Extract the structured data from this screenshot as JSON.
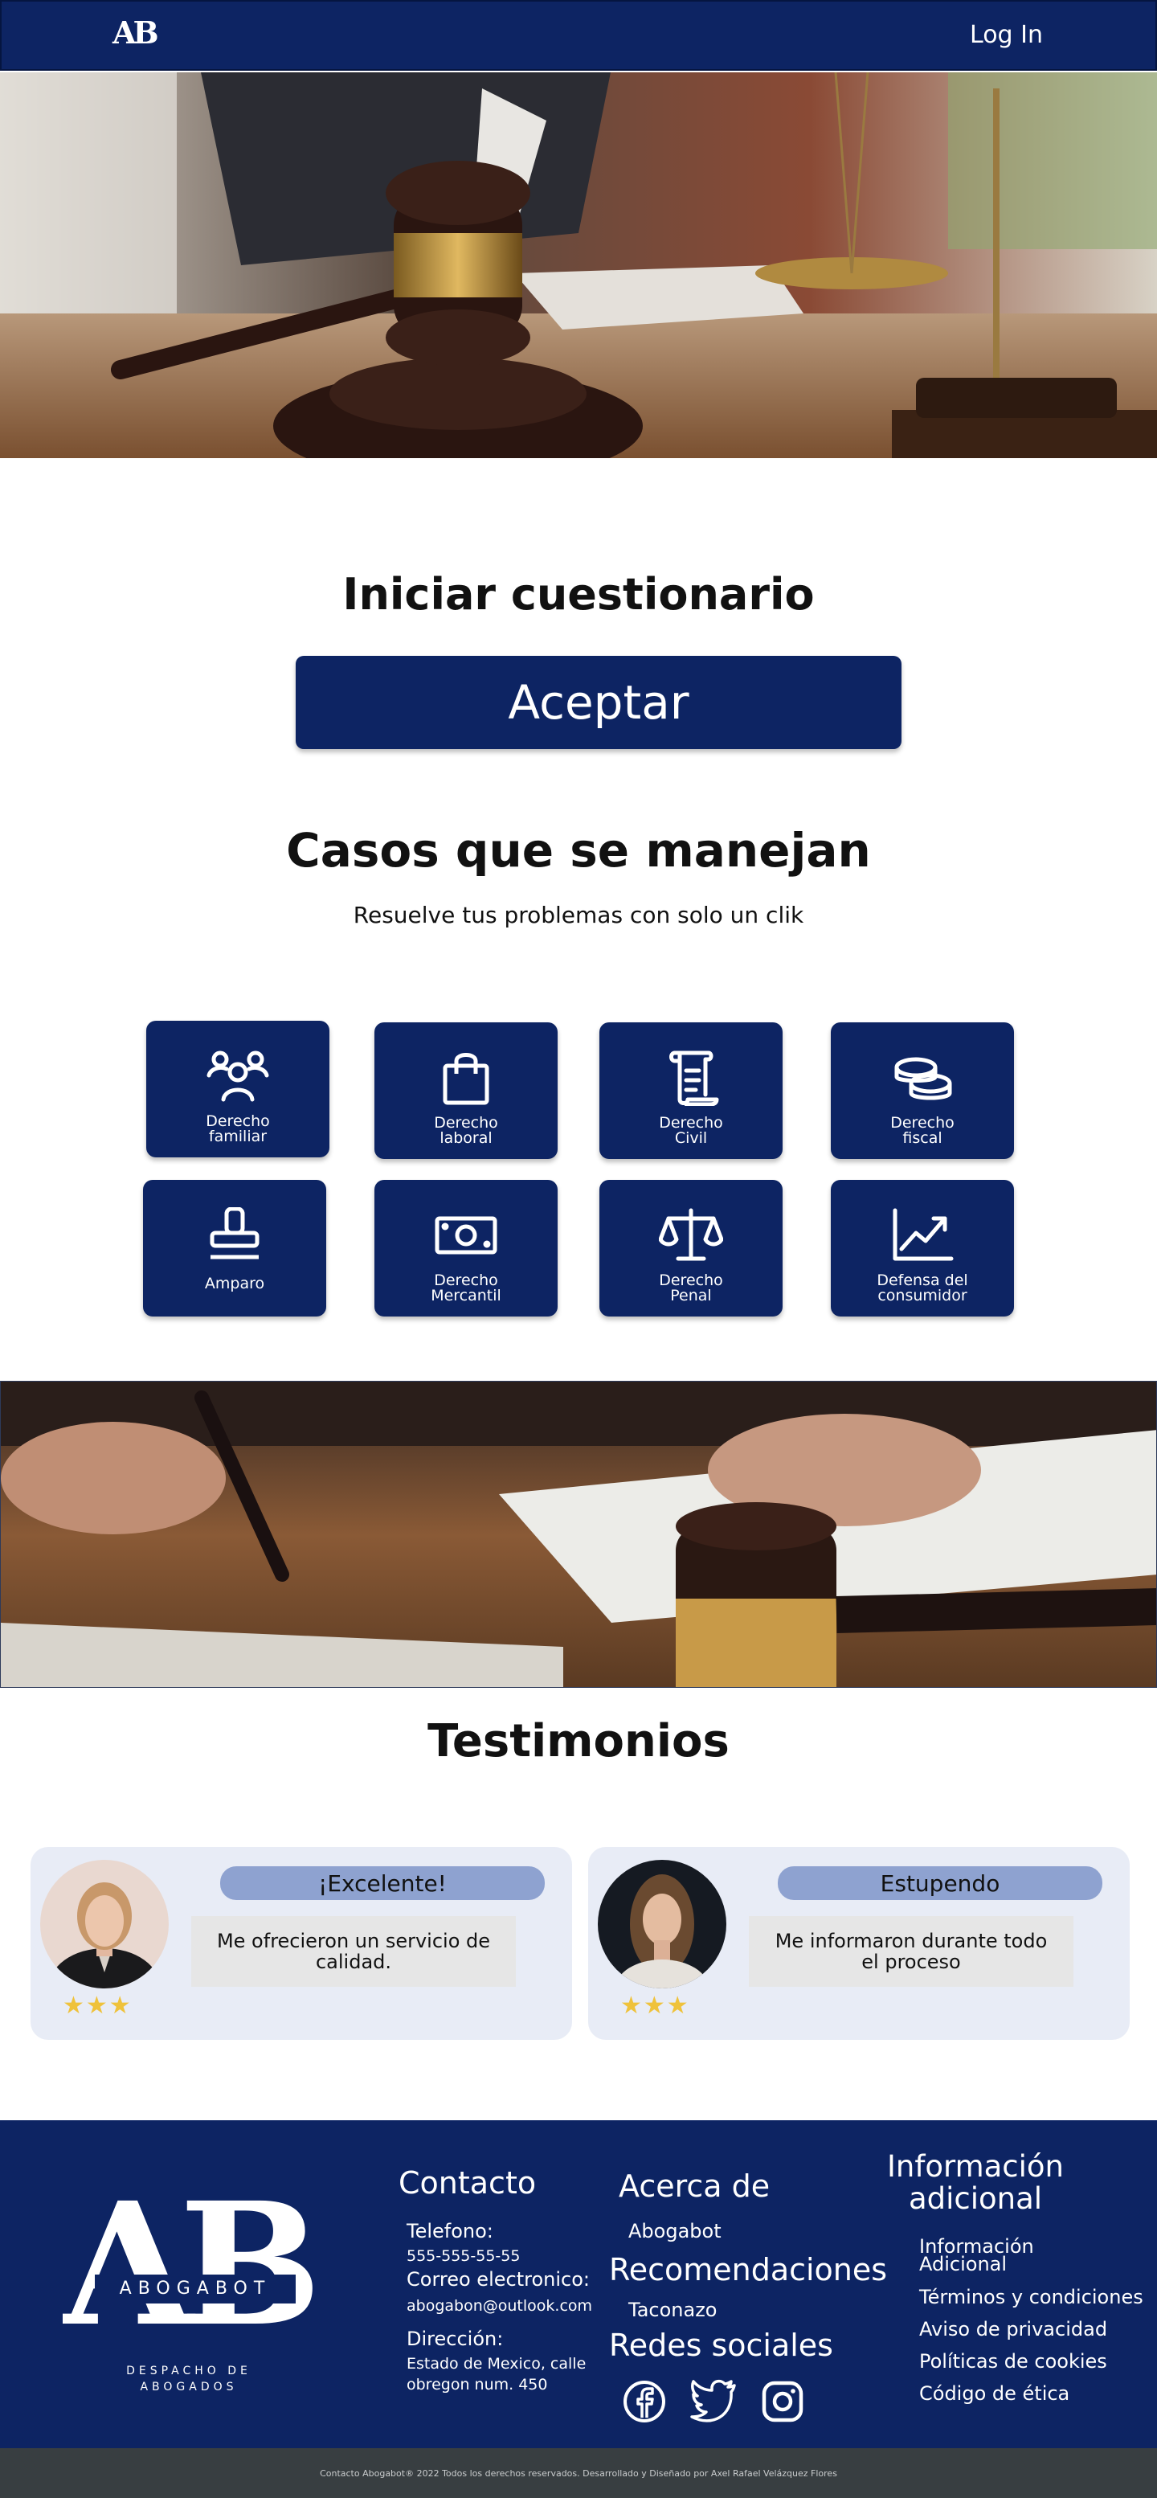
{
  "nav": {
    "logo": "AB",
    "login": "Log In"
  },
  "quiz": {
    "title": "Iniciar cuestionario",
    "button": "Aceptar"
  },
  "cases": {
    "title": "Casos que se manejan",
    "subtitle": "Resuelve tus problemas con solo un clik",
    "items": [
      {
        "line1": "Derecho",
        "line2": "familiar",
        "icon": "family-icon"
      },
      {
        "line1": "Derecho",
        "line2": "laboral",
        "icon": "shopping-bag-icon"
      },
      {
        "line1": "Derecho",
        "line2": "Civil",
        "icon": "scroll-icon"
      },
      {
        "line1": "Derecho",
        "line2": "fiscal",
        "icon": "coins-icon"
      },
      {
        "line1": "Amparo",
        "line2": "",
        "icon": "stamp-icon"
      },
      {
        "line1": "Derecho",
        "line2": "Mercantil",
        "icon": "money-bill-icon"
      },
      {
        "line1": "Derecho",
        "line2": "Penal",
        "icon": "scales-icon"
      },
      {
        "line1": "Defensa del",
        "line2": "consumidor",
        "icon": "chart-line-icon"
      }
    ]
  },
  "testimonials": {
    "title": "Testimonios",
    "items": [
      {
        "badge": "¡Excelente!",
        "quote": "Me ofrecieron un servicio de calidad.",
        "stars": "★★★"
      },
      {
        "badge": "Estupendo",
        "quote": "Me informaron durante todo el proceso",
        "stars": "★★★"
      }
    ]
  },
  "footer": {
    "logo": "AB",
    "brand": "ABOGABOT",
    "tagline1": "DESPACHO DE",
    "tagline2": "ABOGADOS",
    "contact": {
      "title": "Contacto",
      "phone_label": "Telefono:",
      "phone": "555-555-55-55",
      "email_label": "Correo electronico:",
      "email": "abogabon@outlook.com",
      "address_label": "Dirección:",
      "address1": "Estado de Mexico, calle",
      "address2": "obregon num. 450"
    },
    "about": {
      "title": "Acerca de",
      "item": "Abogabot"
    },
    "recs": {
      "title": "Recomendaciones",
      "item": "Taconazo"
    },
    "social": {
      "title": "Redes sociales"
    },
    "info": {
      "title1": "Información",
      "title2": "adicional",
      "links": [
        "Información",
        "Adicional",
        "Términos y condiciones",
        "Aviso de privacidad",
        "Políticas de cookies",
        "Código de ética"
      ]
    }
  },
  "copyright": "Contacto Abogabot® 2022 Todos los derechos reservados. Desarrollado y Diseñado por Axel Rafael Velázquez Flores",
  "colors": {
    "navy": "#0d2463",
    "badge": "#8ea2d0",
    "card": "#e8ecf6",
    "star": "#efc23b",
    "bottom": "#383e41"
  }
}
